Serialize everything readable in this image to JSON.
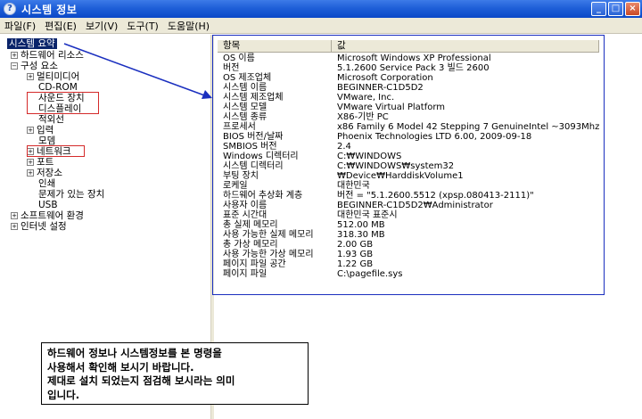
{
  "window": {
    "title": "시스템 정보",
    "icon": "help-icon"
  },
  "controls": {
    "minimize": "_",
    "maximize": "□",
    "close": "×"
  },
  "menu": [
    {
      "label": "파일(F)"
    },
    {
      "label": "편집(E)"
    },
    {
      "label": "보기(V)"
    },
    {
      "label": "도구(T)"
    },
    {
      "label": "도움말(H)"
    }
  ],
  "tree": [
    {
      "label": "시스템 요약",
      "expander": "",
      "selected": true
    },
    {
      "label": "하드웨어 리소스",
      "expander": "+"
    },
    {
      "label": "구성 요소",
      "expander": "−"
    },
    {
      "label": "멀티미디어",
      "expander": "+"
    },
    {
      "label": "CD-ROM",
      "expander": ""
    },
    {
      "label": "사운드 장치",
      "expander": ""
    },
    {
      "label": "디스플레이",
      "expander": ""
    },
    {
      "label": "적외선",
      "expander": ""
    },
    {
      "label": "입력",
      "expander": "+"
    },
    {
      "label": "모뎀",
      "expander": ""
    },
    {
      "label": "네트워크",
      "expander": "+"
    },
    {
      "label": "포트",
      "expander": "+"
    },
    {
      "label": "저장소",
      "expander": "+"
    },
    {
      "label": "인쇄",
      "expander": ""
    },
    {
      "label": "문제가 있는 장치",
      "expander": ""
    },
    {
      "label": "USB",
      "expander": ""
    },
    {
      "label": "소프트웨어 환경",
      "expander": "+"
    },
    {
      "label": "인터넷 설정",
      "expander": "+"
    }
  ],
  "table": {
    "headers": {
      "item": "항목",
      "value": "값"
    },
    "rows": [
      {
        "k": "OS 이름",
        "v": "Microsoft Windows XP Professional"
      },
      {
        "k": "버전",
        "v": "5.1.2600 Service Pack 3 빌드 2600"
      },
      {
        "k": "OS 제조업체",
        "v": "Microsoft Corporation"
      },
      {
        "k": "시스템 이름",
        "v": "BEGINNER-C1D5D2"
      },
      {
        "k": "시스템 제조업체",
        "v": "VMware, Inc."
      },
      {
        "k": "시스템 모델",
        "v": "VMware Virtual Platform"
      },
      {
        "k": "시스템 종류",
        "v": "X86-기반 PC"
      },
      {
        "k": "프로세서",
        "v": "x86 Family 6 Model 42 Stepping 7 GenuineIntel ~3093Mhz"
      },
      {
        "k": "BIOS 버전/날짜",
        "v": "Phoenix Technologies LTD 6.00, 2009-09-18"
      },
      {
        "k": "SMBIOS 버전",
        "v": "2.4"
      },
      {
        "k": "Windows 디렉터리",
        "v": "C:₩WINDOWS"
      },
      {
        "k": "시스템 디렉터리",
        "v": "C:₩WINDOWS₩system32"
      },
      {
        "k": "부팅 장치",
        "v": "₩Device₩HarddiskVolume1"
      },
      {
        "k": "로케일",
        "v": "대한민국"
      },
      {
        "k": "하드웨어 추상화 계층",
        "v": "버전 = \"5.1.2600.5512 (xpsp.080413-2111)\""
      },
      {
        "k": "사용자 이름",
        "v": "BEGINNER-C1D5D2₩Administrator"
      },
      {
        "k": "표준 시간대",
        "v": "대한민국 표준시"
      },
      {
        "k": "총 실제 메모리",
        "v": "512.00 MB"
      },
      {
        "k": "사용 가능한 실제 메모리",
        "v": "318.30 MB"
      },
      {
        "k": "총 가상 메모리",
        "v": "2.00 GB"
      },
      {
        "k": "사용 가능한 가상 메모리",
        "v": "1.93 GB"
      },
      {
        "k": "페이지 파일 공간",
        "v": "1.22 GB"
      },
      {
        "k": "페이지 파일",
        "v": "C:\\pagefile.sys"
      }
    ]
  },
  "note": [
    "하드웨어 정보나 시스템정보를 본 명령을",
    "사용해서 확인해 보시기 바랍니다.",
    "제대로 설치 되었는지 점검해 보시라는 의미",
    "입니다."
  ],
  "colors": {
    "highlight_red": "#d42a2a",
    "highlight_blue": "#1a2fbf",
    "selection": "#0a246a"
  }
}
